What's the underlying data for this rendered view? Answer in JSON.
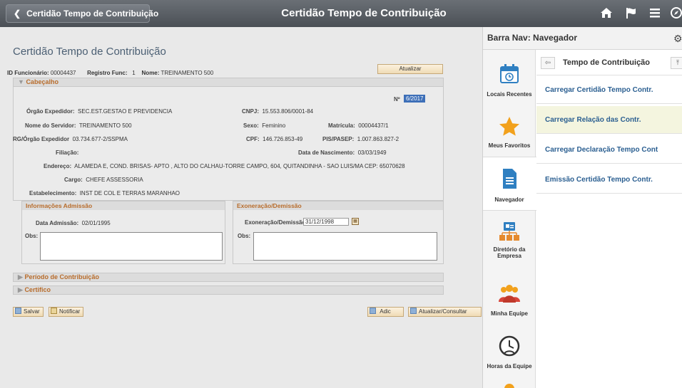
{
  "topbar": {
    "back_label": "Certidão Tempo de Contribuição",
    "title": "Certidão Tempo de Contribuição",
    "icons": [
      "home-icon",
      "flag-icon",
      "menu-icon",
      "compass-icon"
    ],
    "bg_color": "#55595f"
  },
  "page": {
    "title": "Certidão Tempo de Contribuição",
    "header_line": {
      "id_label": "ID Funcionário:",
      "id_value": "00004437",
      "reg_label": "Registro Func:",
      "reg_value": "1",
      "name_label": "Nome:",
      "name_value": "TREINAMENTO 500"
    },
    "update_button": "Atualizar"
  },
  "cabecalho": {
    "title": "Cabeçalho",
    "numero_label": "Nº",
    "numero_value": "6/2017",
    "orgao_label": "Órgão Expedidor:",
    "orgao_value": "SEC.EST.GESTAO E PREVIDENCIA",
    "cnpj_label": "CNPJ:",
    "cnpj_value": "15.553.806/0001-84",
    "servidor_label": "Nome do Servidor:",
    "servidor_value": "TREINAMENTO 500",
    "sexo_label": "Sexo:",
    "sexo_value": "Feminino",
    "matricula_label": "Matrícula:",
    "matricula_value": "00004437/1",
    "rg_label": "RG/Órgão Expedidor",
    "rg_value": "03.734.677-2/SSPMA",
    "cpf_label": "CPF:",
    "cpf_value": "146.726.853-49",
    "pis_label": "PIS/PASEP:",
    "pis_value": "1.007.863.827-2",
    "filiacao_label": "Filiação:",
    "nasc_label": "Data de Nascimento:",
    "nasc_value": "03/03/1949",
    "endereco_label": "Endereço:",
    "endereco_value": "ALAMEDA E, COND. BRISAS- APTO , ALTO DO CALHAU-TORRE CAMPO, 604, QUITANDINHA - SAO LUIS/MA CEP: 65070628",
    "cargo_label": "Cargo:",
    "cargo_value": "CHEFE ASSESSORIA",
    "estab_label": "Estabelecimento:",
    "estab_value": "INST DE COL E TERRAS MARANHAO"
  },
  "admissao": {
    "title": "Informações Admissão",
    "data_label": "Data Admissão:",
    "data_value": "02/01/1995",
    "obs_label": "Obs:"
  },
  "exoneracao": {
    "title": "Exoneração/Demissão",
    "data_label": "Exoneração/Demissão:",
    "data_value": "31/12/1998",
    "obs_label": "Obs:"
  },
  "sections": {
    "periodo": "Período de Contribuição",
    "certifico": "Certifico"
  },
  "actions": {
    "salvar": "Salvar",
    "notificar": "Notificar",
    "adic": "Adic",
    "atualizar_consultar": "Atualizar/Consultar"
  },
  "nav": {
    "header": "Barra Nav: Navegador",
    "tiles": [
      {
        "label": "Locais Recentes",
        "icon": "calendar-clock-icon"
      },
      {
        "label": "Meus Favoritos",
        "icon": "star-icon"
      },
      {
        "label": "Navegador",
        "icon": "document-icon"
      },
      {
        "label": "Diretório da Empresa",
        "icon": "org-chart-icon"
      },
      {
        "label": "Minha Equipe",
        "icon": "team-icon"
      },
      {
        "label": "Horas da Equipe",
        "icon": "team-clock-icon"
      }
    ],
    "crumb": "Tempo de Contribuição",
    "items": [
      "Carregar Certidão Tempo Contr.",
      "Carregar Relação das Contr.",
      "Carregar Declaração Tempo Cont",
      "Emissão Certidão Tempo Contr."
    ],
    "link_color": "#2b5f91",
    "selected_bg": "#f4f5df"
  }
}
